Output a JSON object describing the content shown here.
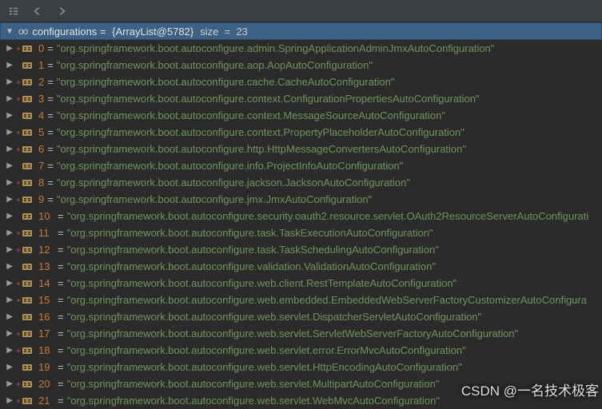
{
  "toolbar": {
    "settings_title": "Settings",
    "back_title": "Back",
    "forward_title": "Forward"
  },
  "header": {
    "name": "configurations",
    "summary": "{ArrayList@5782}",
    "size_label": "size",
    "size_value": "23"
  },
  "items": [
    {
      "index": "0",
      "value": "\"org.springframework.boot.autoconfigure.admin.SpringApplicationAdminJmxAutoConfiguration\""
    },
    {
      "index": "1",
      "value": "\"org.springframework.boot.autoconfigure.aop.AopAutoConfiguration\""
    },
    {
      "index": "2",
      "value": "\"org.springframework.boot.autoconfigure.cache.CacheAutoConfiguration\""
    },
    {
      "index": "3",
      "value": "\"org.springframework.boot.autoconfigure.context.ConfigurationPropertiesAutoConfiguration\""
    },
    {
      "index": "4",
      "value": "\"org.springframework.boot.autoconfigure.context.MessageSourceAutoConfiguration\""
    },
    {
      "index": "5",
      "value": "\"org.springframework.boot.autoconfigure.context.PropertyPlaceholderAutoConfiguration\""
    },
    {
      "index": "6",
      "value": "\"org.springframework.boot.autoconfigure.http.HttpMessageConvertersAutoConfiguration\""
    },
    {
      "index": "7",
      "value": "\"org.springframework.boot.autoconfigure.info.ProjectInfoAutoConfiguration\""
    },
    {
      "index": "8",
      "value": "\"org.springframework.boot.autoconfigure.jackson.JacksonAutoConfiguration\""
    },
    {
      "index": "9",
      "value": "\"org.springframework.boot.autoconfigure.jmx.JmxAutoConfiguration\""
    },
    {
      "index": "10",
      "value": "\"org.springframework.boot.autoconfigure.security.oauth2.resource.servlet.OAuth2ResourceServerAutoConfigurati"
    },
    {
      "index": "11",
      "value": "\"org.springframework.boot.autoconfigure.task.TaskExecutionAutoConfiguration\""
    },
    {
      "index": "12",
      "value": "\"org.springframework.boot.autoconfigure.task.TaskSchedulingAutoConfiguration\""
    },
    {
      "index": "13",
      "value": "\"org.springframework.boot.autoconfigure.validation.ValidationAutoConfiguration\""
    },
    {
      "index": "14",
      "value": "\"org.springframework.boot.autoconfigure.web.client.RestTemplateAutoConfiguration\""
    },
    {
      "index": "15",
      "value": "\"org.springframework.boot.autoconfigure.web.embedded.EmbeddedWebServerFactoryCustomizerAutoConfigura"
    },
    {
      "index": "16",
      "value": "\"org.springframework.boot.autoconfigure.web.servlet.DispatcherServletAutoConfiguration\""
    },
    {
      "index": "17",
      "value": "\"org.springframework.boot.autoconfigure.web.servlet.ServletWebServerFactoryAutoConfiguration\""
    },
    {
      "index": "18",
      "value": "\"org.springframework.boot.autoconfigure.web.servlet.error.ErrorMvcAutoConfiguration\""
    },
    {
      "index": "19",
      "value": "\"org.springframework.boot.autoconfigure.web.servlet.HttpEncodingAutoConfiguration\""
    },
    {
      "index": "20",
      "value": "\"org.springframework.boot.autoconfigure.web.servlet.MultipartAutoConfiguration\""
    },
    {
      "index": "21",
      "value": "\"org.springframework.boot.autoconfigure.web.servlet.WebMvcAutoConfiguration\""
    }
  ],
  "watermark": "CSDN @一名技术极客"
}
